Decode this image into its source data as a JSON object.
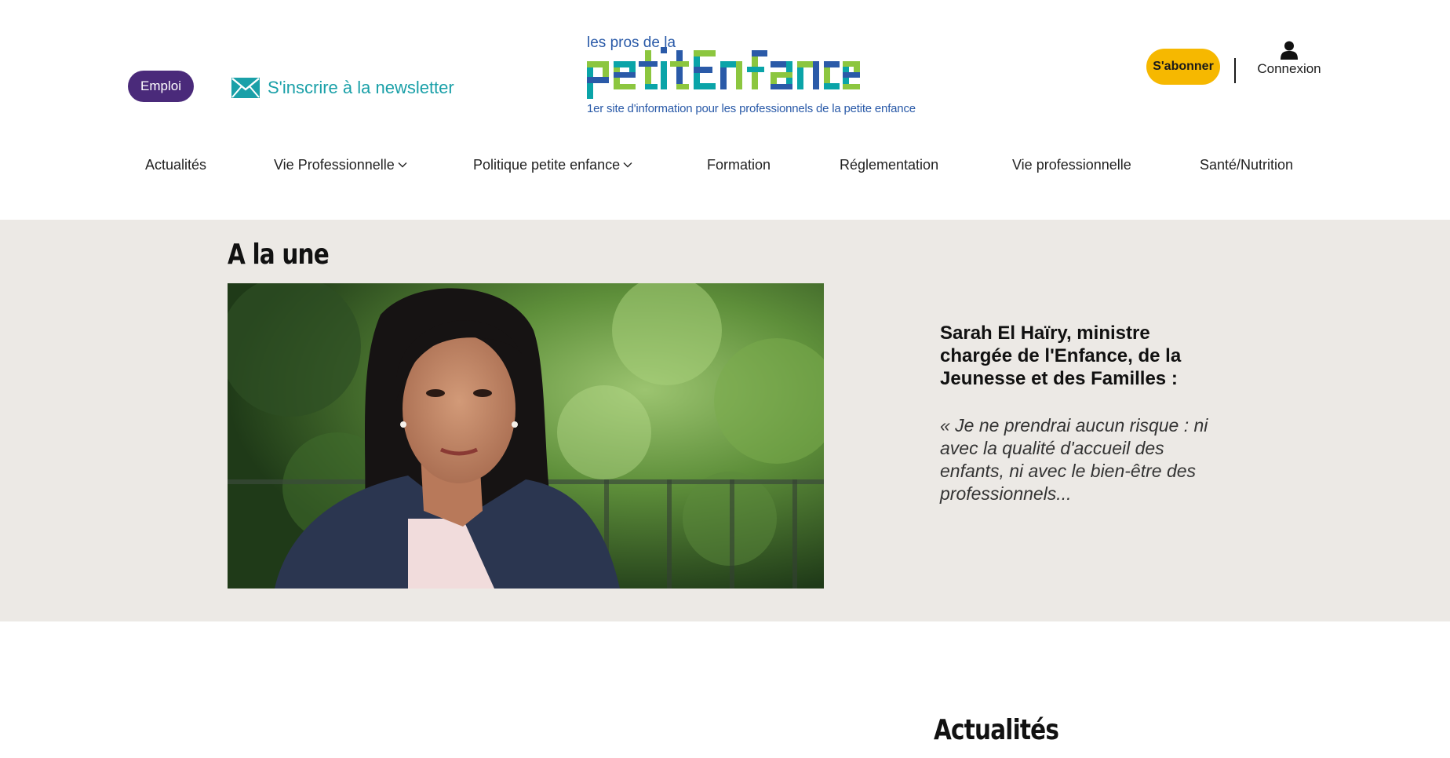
{
  "header": {
    "emploi_label": "Emploi",
    "newsletter_label": "S'inscrire à la newsletter",
    "logo": {
      "small_title": "les pros de la",
      "wordmark": "petitEnfance",
      "tagline": "1er site d'information pour les professionnels de la petite enfance"
    },
    "subscribe_label": "S'abonner",
    "login_label": "Connexion"
  },
  "nav": {
    "items": [
      {
        "label": "Actualités",
        "has_dropdown": false
      },
      {
        "label": "Vie Professionnelle",
        "has_dropdown": true
      },
      {
        "label": "Politique petite enfance",
        "has_dropdown": true
      },
      {
        "label": "Formation",
        "has_dropdown": false
      },
      {
        "label": "Réglementation",
        "has_dropdown": false
      },
      {
        "label": "Vie professionnelle",
        "has_dropdown": false
      },
      {
        "label": "Santé/Nutrition",
        "has_dropdown": false
      }
    ]
  },
  "featured": {
    "section_title": "A la une",
    "headline": "Sarah El Haïry, ministre chargée de l'Enfance, de la Jeunesse et des Familles :",
    "quote": "« Je ne prendrai aucun risque : ni avec la qualité d'accueil des enfants, ni avec le bien-être des professionnels..."
  },
  "news": {
    "section_title": "Actualités"
  },
  "colors": {
    "emploi_bg": "#4a2a7a",
    "newsletter_text": "#1aa0a8",
    "subscribe_bg": "#f6b800",
    "featured_bg": "#ece9e5",
    "logo_blue": "#2a5aa8",
    "logo_green": "#8cc63f",
    "logo_teal": "#0aa4a8"
  }
}
